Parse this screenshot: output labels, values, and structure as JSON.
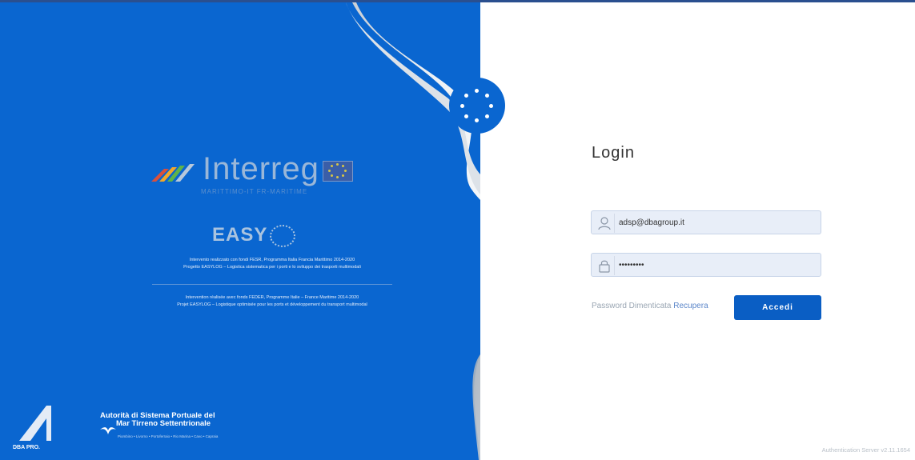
{
  "brand": {
    "name": "Interreg",
    "subtitle": "MARITTIMO-IT FR-MARITIME",
    "project": "EASY",
    "colors": {
      "primary": "#0a66d0",
      "button": "#0a5ec4",
      "link": "#5b86c9"
    }
  },
  "description": {
    "it_line1": "Intervento realizzato con fondi FESR, Programma Italia Francia Marittimo 2014-2020",
    "it_line2": "Progetto EASYLOG – Logistica sistematica per i porti e lo sviluppo dei trasporti multimodali",
    "fr_line1": "Intervention réalisée avec fonds FEDER, Programme Italie – France Maritime 2014-2020",
    "fr_line2": "Projet EASYLOG – Logistique optimisée pour les ports et développement du transport multimodal"
  },
  "footer_logos": {
    "left_label": "DBA PRO.",
    "port_line1": "Autorità di Sistema Portuale del",
    "port_line2": "Mar Tirreno Settentrionale",
    "port_sub": "Piombino • Livorno • Portoferraio • Rio Marina • Cavo • Capraia"
  },
  "login": {
    "title": "Login",
    "username_value": "adsp@dbagroup.it",
    "username_icon": "user-icon",
    "password_value": "•••••••••",
    "password_icon": "lock-icon",
    "forgot_prefix": "Password Dimenticata",
    "forgot_link": "Recupera",
    "submit_label": "Accedi"
  },
  "version": "Authentication Server v2.11.1654"
}
